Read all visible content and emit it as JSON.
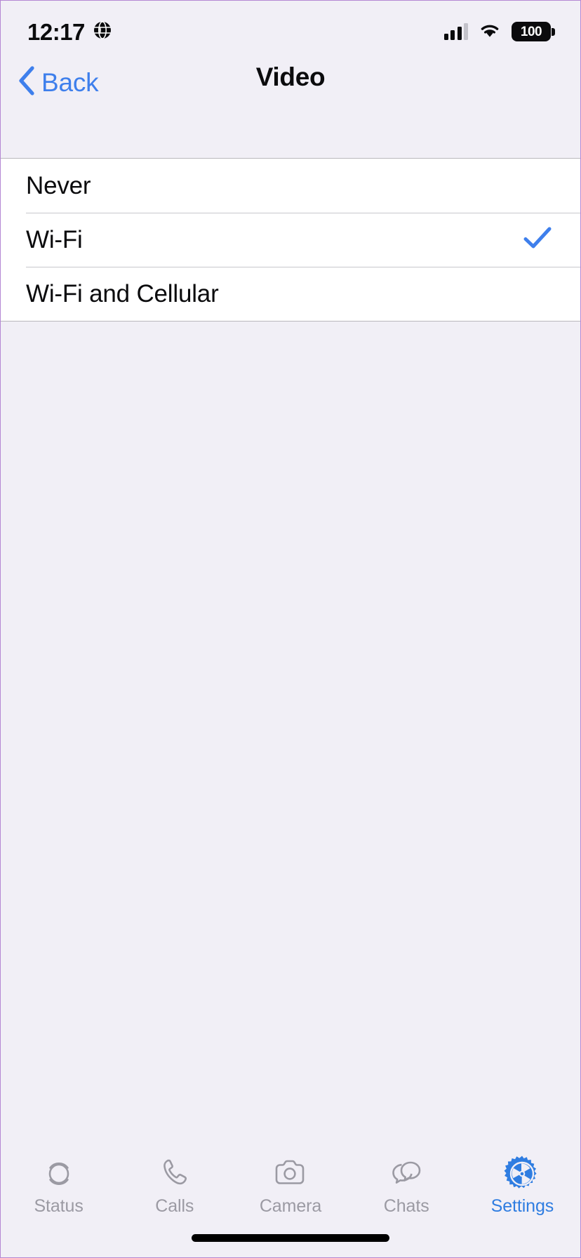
{
  "theme": {
    "background": "#f1eff6",
    "card_background": "#ffffff",
    "accent_blue": "#3e7fec",
    "tab_active_blue": "#2f7de1",
    "tab_inactive_gray": "#9b9aa3",
    "text_primary": "#0b0b0d",
    "separator": "#c8c7cc",
    "frame_border": "#b487d4"
  },
  "status_bar": {
    "time": "12:17",
    "globe_icon": "globe-icon",
    "signal_icon": "cellular-signal-icon",
    "signal_bars_filled": 3,
    "signal_bars_total": 4,
    "wifi_icon": "wifi-icon",
    "battery_icon": "battery-icon",
    "battery_level": "100"
  },
  "nav_bar": {
    "back_icon": "chevron-left-icon",
    "back_label": "Back",
    "title": "Video"
  },
  "options": {
    "items": [
      {
        "label": "Never",
        "selected": false,
        "check_icon": "checkmark-icon"
      },
      {
        "label": "Wi-Fi",
        "selected": true,
        "check_icon": "checkmark-icon"
      },
      {
        "label": "Wi-Fi and Cellular",
        "selected": false,
        "check_icon": "checkmark-icon"
      }
    ]
  },
  "tab_bar": {
    "tabs": [
      {
        "label": "Status",
        "icon": "status-rings-icon",
        "active": false
      },
      {
        "label": "Calls",
        "icon": "phone-icon",
        "active": false
      },
      {
        "label": "Camera",
        "icon": "camera-icon",
        "active": false
      },
      {
        "label": "Chats",
        "icon": "chat-bubbles-icon",
        "active": false
      },
      {
        "label": "Settings",
        "icon": "gear-icon",
        "active": true
      }
    ]
  },
  "home_indicator": {
    "name": "home-indicator"
  }
}
